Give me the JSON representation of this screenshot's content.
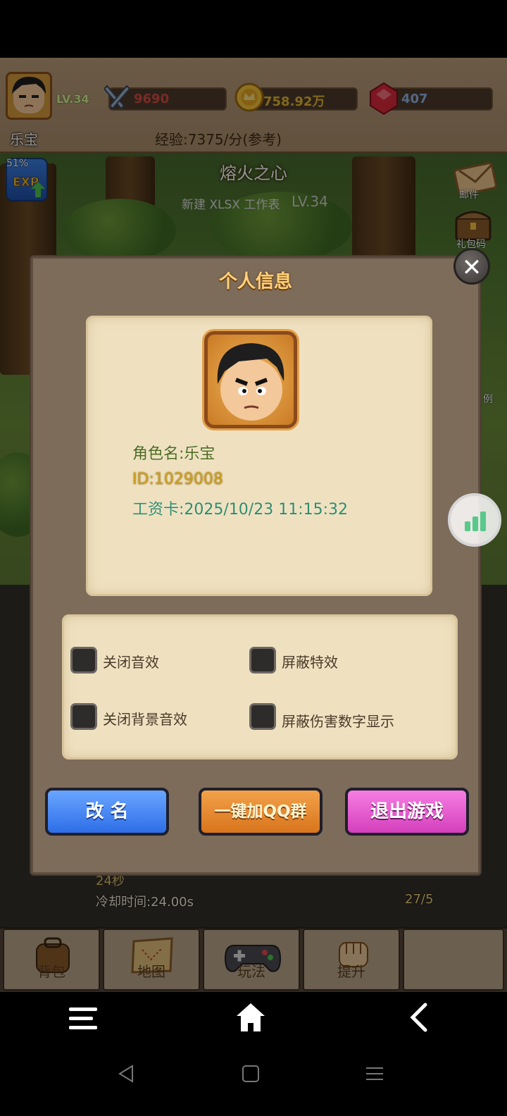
{
  "status_bar": {
    "level": "LV.34",
    "player_name": "乐宝",
    "combat_power": "9690",
    "gold": "758.92万",
    "gems": "407",
    "exp_rate": "经验:7375/分(参考)"
  },
  "scene": {
    "zone_name": "熔火之心",
    "zone_subtitle": "新建 XLSX 工作表",
    "zone_level": "LV.34",
    "exp_percent": "51%",
    "side_buttons": [
      "邮件",
      "礼包码",
      "例"
    ],
    "skill_timer": "24秒",
    "cooldown": "冷却时间:24.00s",
    "counter": "27/5"
  },
  "dialog": {
    "title": "个人信息",
    "role_name": "角色名:乐宝",
    "id": "ID:1029008",
    "salary_card": "工资卡:2025/10/23 11:15:32",
    "options": [
      {
        "label": "关闭音效",
        "checked": false
      },
      {
        "label": "屏蔽特效",
        "checked": false
      },
      {
        "label": "关闭背景音效",
        "checked": false
      },
      {
        "label": "屏蔽伤害数字显示",
        "checked": false
      }
    ],
    "buttons": {
      "rename": "改 名",
      "join_qq": "一键加QQ群",
      "exit": "退出游戏"
    }
  },
  "game_nav": [
    "背包",
    "地图",
    "玩法",
    "提升",
    ""
  ],
  "colors": {
    "rename_button": "#2d6ee8",
    "qq_button": "#d8741c",
    "exit_button": "#d43fbc",
    "title_gold": "#ffd27a"
  }
}
